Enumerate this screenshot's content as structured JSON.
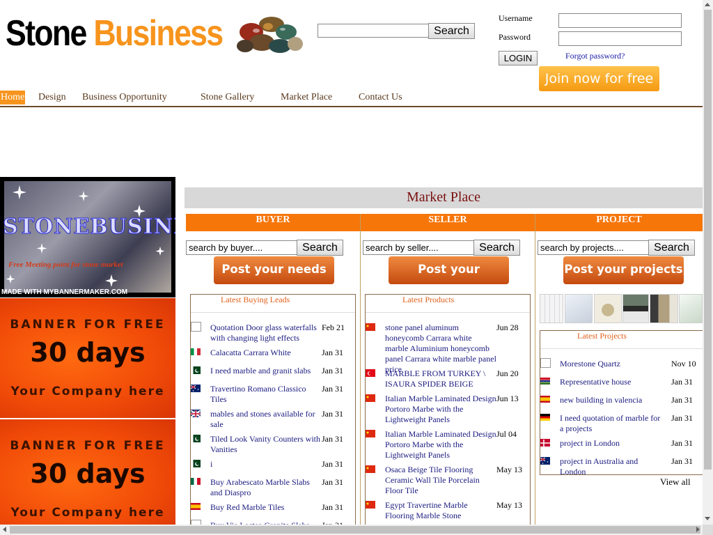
{
  "header": {
    "logo": {
      "word1": "Stone",
      "word2": "Business"
    },
    "search_button": "Search",
    "login": {
      "username_label": "Username",
      "password_label": "Password",
      "login_button": "LOGIN",
      "forgot_link": "Forgot password?"
    },
    "join_button": "Join now for free"
  },
  "nav": {
    "items": [
      "Home",
      "Design",
      "Business Opportunity",
      "Stone Gallery",
      "Market Place",
      "Contact Us"
    ],
    "active": "Home",
    "active_color": "#f7941d"
  },
  "left_banners": {
    "stonebusiness": {
      "title": "STONEBUSINESS",
      "tagline": "Free Meeting point for stone market",
      "credit": "MADE WITH MYBANNERMAKER.COM"
    },
    "free_banners": [
      {
        "line1": "BANNER FOR FREE",
        "line2": "30 days",
        "line3": "Your Company here"
      },
      {
        "line1": "BANNER FOR FREE",
        "line2": "30 days",
        "line3": "Your Company here"
      }
    ]
  },
  "market_place": {
    "title": "Market Place",
    "accent_color": "#f7760a",
    "columns": {
      "buyer": {
        "heading": "BUYER",
        "search_placeholder": "search by buyer....",
        "search_button": "Search",
        "post_button": "Post your needs"
      },
      "seller": {
        "heading": "SELLER",
        "search_placeholder": "search by seller....",
        "search_button": "Search",
        "post_button": "Post your products"
      },
      "project": {
        "heading": "PROJECT",
        "search_placeholder": "search by projects....",
        "search_button": "Search",
        "post_button": "Post your projects"
      }
    },
    "buying_leads": {
      "title": "Latest Buying Leads",
      "items": [
        {
          "flag": "broken-image",
          "text": "Quotation Door glass waterfalls with changing light effects",
          "date": "Feb 21"
        },
        {
          "flag": "italy",
          "text": "Calacatta Carrara White",
          "date": "Jan 31"
        },
        {
          "flag": "pakistan",
          "text": "I need marble and granit slabs",
          "date": "Jan 31"
        },
        {
          "flag": "australia",
          "text": "Travertino Romano Classico Tiles",
          "date": "Jan 31"
        },
        {
          "flag": "uk",
          "text": "mables and stones available for sale",
          "date": "Jan 31"
        },
        {
          "flag": "pakistan",
          "text": "Tiled Look Vanity Counters with Vanities",
          "date": "Jan 31"
        },
        {
          "flag": "pakistan",
          "text": "i",
          "date": "Jan 31"
        },
        {
          "flag": "mexico",
          "text": "Buy Arabescato Marble Slabs and Diaspro",
          "date": "Jan 31"
        },
        {
          "flag": "spain",
          "text": "Buy Red Marble Tiles",
          "date": "Jan 31"
        },
        {
          "flag": "broken-image",
          "text": "Buy Via Lactea Granite Slabs and",
          "date": "Jan 31"
        }
      ]
    },
    "latest_products": {
      "title": "Latest Products",
      "items": [
        {
          "flag": "china",
          "text": "stone panel aluminum honeycomb Carrara white marble Aluminium honeycomb panel Carrara white marble panel price",
          "date": "Jun 28"
        },
        {
          "flag": "turkey",
          "text": "MARBLE FROM TURKEY \\ ISAURA SPIDER BEIGE",
          "date": "Jun 20"
        },
        {
          "flag": "china",
          "text": "Italian Marble Laminated Design Portoro Marbe with the Lightweight Panels",
          "date": "Jun 13"
        },
        {
          "flag": "china",
          "text": "Italian Marble Laminated Design Portoro Marbe with the Lightweight Panels",
          "date": "Jul 04"
        },
        {
          "flag": "china",
          "text": "Osaca Beige Tile Flooring Ceramic Wall Tile Porcelain Floor Tile",
          "date": "May 13"
        },
        {
          "flag": "china",
          "text": "Egypt Travertine Marble Flooring Marble Stone",
          "date": "May 13"
        }
      ]
    },
    "latest_projects": {
      "title": "Latest Projects",
      "items": [
        {
          "flag": "broken-image",
          "text": "Morestone Quartz",
          "date": "Nov 10"
        },
        {
          "flag": "gambia",
          "text": "Representative house",
          "date": "Jan 31"
        },
        {
          "flag": "spain",
          "text": "new building in valencia",
          "date": "Jan 31"
        },
        {
          "flag": "germany",
          "text": "I need quotation of marble for a projects",
          "date": "Jan 31"
        },
        {
          "flag": "denmark",
          "text": "project in London",
          "date": "Jan 31"
        },
        {
          "flag": "australia",
          "text": "project in Australia and London",
          "date": "Jan 31"
        }
      ],
      "view_all": "View all"
    }
  }
}
